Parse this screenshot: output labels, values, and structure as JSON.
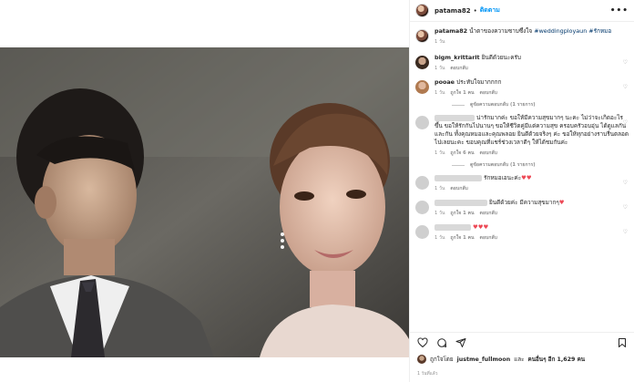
{
  "post": {
    "username": "patama82",
    "follow_label": "ติดตาม",
    "more_label": "•••",
    "caption_user": "patama82",
    "caption_text": "น้ำตาของความซาบซึ้งใจ",
    "caption_tags": "#weddingployaun #รักหมอ",
    "caption_time": "1 วัน"
  },
  "comments": [
    {
      "user": "bigm_krittarit",
      "text": "ยินดีด้วยนะครับ",
      "time": "1 วัน",
      "reply": "ตอบกลับ",
      "likes": ""
    },
    {
      "user": "pooae",
      "text": "ประทับใจมากกกก",
      "time": "1 วัน",
      "likes": "ถูกใจ 1 คน",
      "reply": "ตอบกลับ",
      "replies": "ดูข้อความตอบกลับ (1 รายการ)"
    },
    {
      "text": "น่ารักมากค่ะ ขอให้มีความสุขมากๆ นะคะ ไม่ว่าจะเกิดอะไรขึ้น ขอให้รักกันไปนานๆ ขอให้ชีวิตคู่มีแต่ความสุข ครอบครัวอบอุ่น ได้ดูแลกันและกัน ทั้งคุณหมอและคุณพลอย ยินดีด้วยจริงๆ ค่ะ ขอให้ทุกอย่างราบรื่นตลอดไปเลยนะคะ ขอบคุณที่แชร์ช่วงเวลาดีๆ ให้ได้ชมกันค่ะ",
      "time": "1 วัน",
      "likes": "ถูกใจ 6 คน",
      "reply": "ตอบกลับ",
      "replies": "ดูข้อความตอบกลับ (1 รายการ)"
    },
    {
      "text": "รักหมอเอนะค่ะ",
      "emoji": "♥♥",
      "time": "1 วัน",
      "reply": "ตอบกลับ"
    },
    {
      "text": "ยินดีด้วยค่ะ มีความสุขมากๆ",
      "emoji": "♥",
      "time": "1 วัน",
      "likes": "ถูกใจ 1 คน",
      "reply": "ตอบกลับ"
    },
    {
      "text": "",
      "emoji": "♥♥♥",
      "time": "1 วัน",
      "likes": "ถูกใจ 1 คน",
      "reply": "ตอบกลับ"
    }
  ],
  "footer": {
    "liked_prefix": "ถูกใจโดย",
    "liked_user": "justme_fullmoon",
    "liked_and": "และ",
    "liked_others": "คนอื่นๆ อีก 1,629 คน",
    "post_time": "1 วันที่แล้ว"
  },
  "icons": [
    "heart-icon",
    "comment-icon",
    "share-icon",
    "bookmark-icon",
    "more-icon"
  ]
}
